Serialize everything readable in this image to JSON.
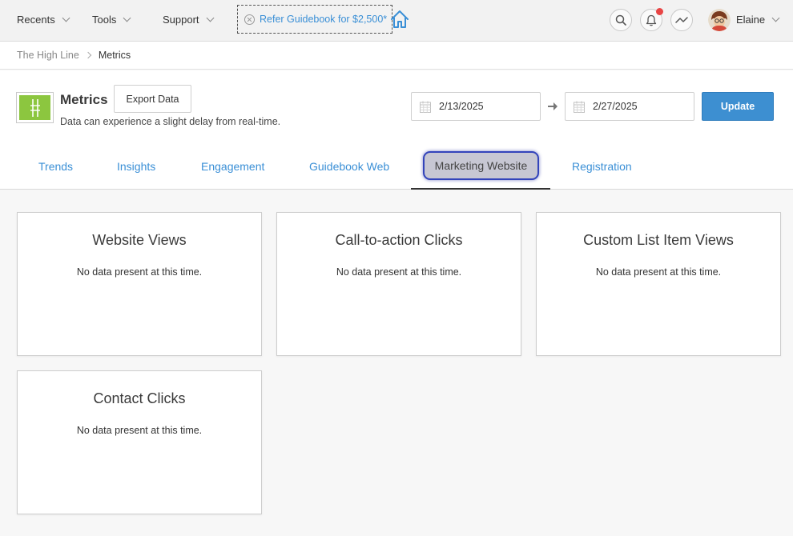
{
  "topbar": {
    "nav": [
      {
        "label": "Recents"
      },
      {
        "label": "Tools"
      },
      {
        "label": "Support"
      }
    ],
    "refer_label": "Refer Guidebook for $2,500*",
    "user_name": "Elaine",
    "icons": [
      "search-icon",
      "bell-icon",
      "activity-icon",
      "home-icon",
      "close-icon"
    ],
    "notification_color": "#e84545"
  },
  "breadcrumb": {
    "parent": "The High Line",
    "current": "Metrics"
  },
  "header": {
    "title": "Metrics",
    "export_label": "Export Data",
    "subtitle": "Data can experience a slight delay from real-time.",
    "start_date": "2/13/2025",
    "end_date": "2/27/2025",
    "update_label": "Update",
    "accent_color": "#3d8fd1",
    "logo_color": "#8cc63f"
  },
  "tabs": [
    {
      "label": "Trends"
    },
    {
      "label": "Insights"
    },
    {
      "label": "Engagement"
    },
    {
      "label": "Guidebook Web"
    },
    {
      "label": "Marketing Website",
      "active": true
    },
    {
      "label": "Registration"
    }
  ],
  "cards": [
    {
      "title": "Website Views",
      "message": "No data present at this time."
    },
    {
      "title": "Call-to-action Clicks",
      "message": "No data present at this time."
    },
    {
      "title": "Custom List Item Views",
      "message": "No data present at this time."
    },
    {
      "title": "Contact Clicks",
      "message": "No data present at this time."
    }
  ]
}
